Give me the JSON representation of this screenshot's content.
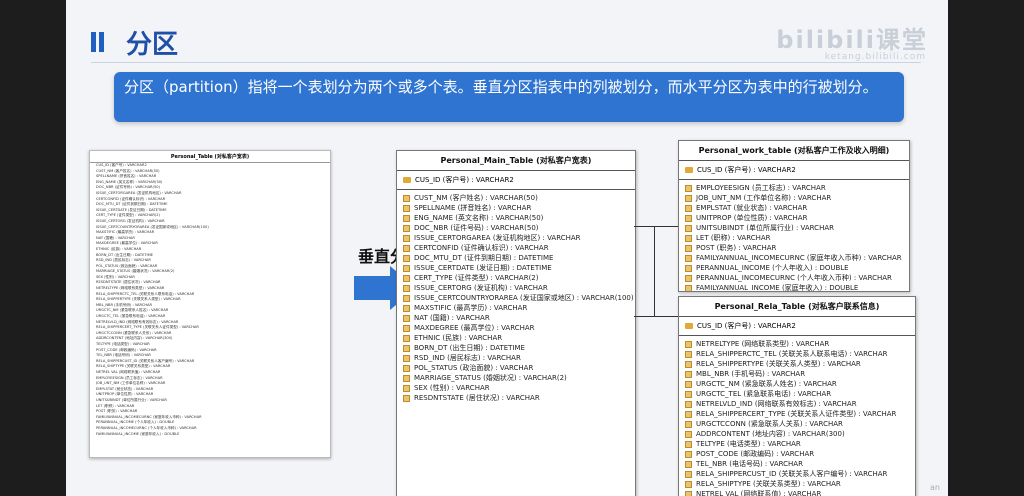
{
  "slide": {
    "title": "分区",
    "logo": "bilibili课堂",
    "logo_sub": "ketang.bilibili.com",
    "description": "分区（partition）指将一个表划分为两个或多个表。垂直分区指表中的列被划分，而水平分区为表中的行被划分。",
    "arrow_label": "垂直分区",
    "corner_text": "an"
  },
  "thumbnail": {
    "title": "Personal_Table (对私客户宽表)",
    "rows": [
      "CUS_ID (客户号) : VARCHAR2",
      "CUST_NM (客户姓名) : VARCHAR(50)",
      "SPELLNAME (拼音姓名) : VARCHAR",
      "ENG_NAME (英文名称) : VARCHAR(50)",
      "DOC_NBR (证件号码) : VARCHAR(50)",
      "ISSUE_CERTORGAREA (发证机构地区) : VARCHAR",
      "CERTCONFID (证件确认标识) : VARCHAR",
      "DOC_MTU_DT (证件到期日期) : DATETIME",
      "ISSUE_CERTDATE (发证日期) : DATETIME",
      "CERT_TYPE (证件类型) : VARCHAR(2)",
      "ISSUE_CERTORG (发证机构) : VARCHAR",
      "ISSUE_CERTCOUNTRYORAREA (发证国家或地区) : VARCHAR(100)",
      "MAXSTIFIC (最高学历) : VARCHAR",
      "NAT (国籍) : VARCHAR",
      "MAXDEGREE (最高学位) : VARCHAR",
      "ETHNIC (民族) : VARCHAR",
      "BORN_DT (出生日期) : DATETIME",
      "RSD_IND (居民标志) : VARCHAR",
      "POL_STATUS (政治面貌) : VARCHAR",
      "MARRIAGE_STATUS (婚姻状况) : VARCHAR(2)",
      "SEX (性别) : VARCHAR",
      "RESDNTSTATE (居住状况) : VARCHAR",
      "NETRELTYPE (网络联系类型) : VARCHAR",
      "RELA_SHIPPERCTC_TEL (关联关系人联系电话) : VARCHAR",
      "RELA_SHIPPERTYPE (关联关系人类型) : VARCHAR",
      "MBL_NBR (手机号码) : VARCHAR",
      "URGCTC_NM (紧急联系人姓名) : VARCHAR",
      "URGCTC_TEL (紧急联系电话) : VARCHAR",
      "NETRELVLD_IND (网络联系有效标志) : VARCHAR",
      "RELA_SHIPPERCERT_TYPE (关联关系人证件类型) : VARCHAR",
      "URGCTCCONN (紧急联系人关系) : VARCHAR",
      "ADDRCONTENT (地址内容) : VARCHAR(300)",
      "TELTYPE (电话类型) : VARCHAR",
      "POST_CODE (邮政编码) : VARCHAR",
      "TEL_NBR (电话号码) : VARCHAR",
      "RELA_SHIPPERCUST_ID (关联关系人客户编号) : VARCHAR",
      "RELA_SHIPTYPE (关联关系类型) : VARCHAR",
      "NETREL VAL (网络联系值) : VARCHAR",
      "EMPLOYEESIGN (员工标志) : VARCHAR",
      "JOB_UNT_NM (工作单位名称) : VARCHAR",
      "EMPLSTAT (就业状态) : VARCHAR",
      "UNITPROP (单位性质) : VARCHAR",
      "UNITSUBINDT (单位所属行业) : VARCHAR",
      "LET (职称) : VARCHAR",
      "POST (职务) : VARCHAR",
      "FAMILYANNUAL_INCOMECURNC (家庭年收入币种) : VARCHAR",
      "PERANNUAL_INCOME (个人年收入) : DOUBLE",
      "PERANNUAL_INCOMECURNC (个人年收入币种) : VARCHAR",
      "FAMILYANNUAL_INCOME (家庭年收入) : DOUBLE"
    ]
  },
  "main_table": {
    "title": "Personal_Main_Table (对私客户宽表)",
    "key": "CUS_ID (客户号) : VARCHAR2",
    "rows": [
      "CUST_NM (客户姓名) : VARCHAR(50)",
      "SPELLNAME (拼音姓名) : VARCHAR",
      "ENG_NAME (英文名称) : VARCHAR(50)",
      "DOC_NBR (证件号码) : VARCHAR(50)",
      "ISSUE_CERTORGAREA (发证机构地区) : VARCHAR",
      "CERTCONFID (证件确认标识) : VARCHAR",
      "DOC_MTU_DT (证件到期日期) : DATETIME",
      "ISSUE_CERTDATE (发证日期) : DATETIME",
      "CERT_TYPE (证件类型) : VARCHAR(2)",
      "ISSUE_CERTORG (发证机构) : VARCHAR",
      "ISSUE_CERTCOUNTRYORAREA (发证国家或地区) : VARCHAR(100)",
      "MAXSTIFIC (最高学历) : VARCHAR",
      "NAT (国籍) : VARCHAR",
      "MAXDEGREE (最高学位) : VARCHAR",
      "ETHNIC (民族) : VARCHAR",
      "BORN_DT (出生日期) : DATETIME",
      "RSD_IND (居民标志) : VARCHAR",
      "POL_STATUS (政治面貌) : VARCHAR",
      "MARRIAGE_STATUS (婚姻状况) : VARCHAR(2)",
      "SEX (性别) : VARCHAR",
      "RESDNTSTATE (居住状况) : VARCHAR"
    ]
  },
  "work_table": {
    "title": "Personal_work_table (对私客户工作及收入明细)",
    "key": "CUS_ID (客户号) : VARCHAR2",
    "rows": [
      "EMPLOYEESIGN (员工标志) : VARCHAR",
      "JOB_UNT_NM (工作单位名称) : VARCHAR",
      "EMPLSTAT (就业状态) : VARCHAR",
      "UNITPROP (单位性质) : VARCHAR",
      "UNITSUBINDT (单位所属行业) : VARCHAR",
      "LET (职称) : VARCHAR",
      "POST (职务) : VARCHAR",
      "FAMILYANNUAL_INCOMECURNC (家庭年收入币种) : VARCHAR",
      "PERANNUAL_INCOME (个人年收入) : DOUBLE",
      "PERANNUAL_INCOMECURNC (个人年收入币种) : VARCHAR",
      "FAMILYANNUAL_INCOME (家庭年收入) : DOUBLE"
    ]
  },
  "rela_table": {
    "title": "Personal_Rela_Table (对私客户联系信息)",
    "key": "CUS_ID (客户号) : VARCHAR2",
    "rows": [
      "NETRELTYPE (网络联系类型) : VARCHAR",
      "RELA_SHIPPERCTC_TEL (关联关系人联系电话) : VARCHAR",
      "RELA_SHIPPERTYPE (关联关系人类型) : VARCHAR",
      "MBL_NBR (手机号码) : VARCHAR",
      "URGCTC_NM (紧急联系人姓名) : VARCHAR",
      "URGCTC_TEL (紧急联系电话) : VARCHAR",
      "NETRELVLD_IND (网络联系有效标志) : VARCHAR",
      "RELA_SHIPPERCERT_TYPE (关联关系人证件类型) : VARCHAR",
      "URGCTCCONN (紧急联系人关系) : VARCHAR",
      "ADDRCONTENT (地址内容) : VARCHAR(300)",
      "TELTYPE (电话类型) : VARCHAR",
      "POST_CODE (邮政编码) : VARCHAR",
      "TEL_NBR (电话号码) : VARCHAR",
      "RELA_SHIPPERCUST_ID (关联关系人客户编号) : VARCHAR",
      "RELA_SHIPTYPE (关联关系类型) : VARCHAR",
      "NETREL VAL (网络联系值) : VARCHAR"
    ]
  }
}
